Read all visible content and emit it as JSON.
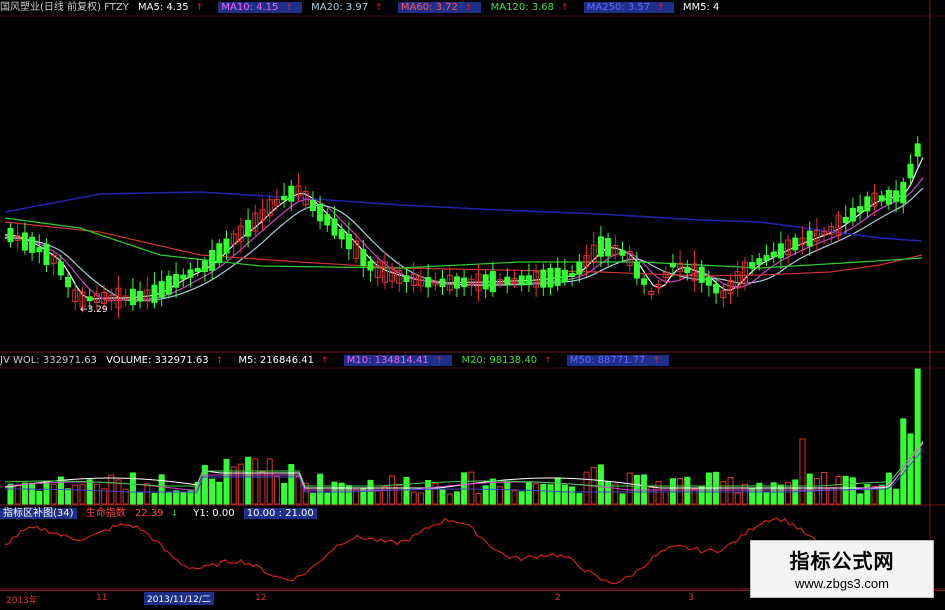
{
  "colors": {
    "background": "#000000",
    "up": "#e03030",
    "down": "#33ff33",
    "ma5": "#ffffff",
    "ma10": "#cc44cc",
    "ma20": "#aaccdd",
    "ma60": "#cc3333",
    "ma120": "#33cc33",
    "ma250": "#2222aa",
    "grid": "#7a1a1a"
  },
  "main_legend": {
    "title": "国风塑业(日线 前复权) FTZY",
    "ma5": "MA5: 4.35",
    "ma10": "MA10: 4.15",
    "ma20": "MA20: 3.97",
    "ma60": "MA60: 3.72",
    "ma120": "MA120: 3.68",
    "ma250": "MA250: 3.57",
    "mm5": "MM5: 4"
  },
  "min_price_label": "3.29",
  "vol_legend": {
    "name": "JV WOL: 332971.63",
    "volume": "VOLUME: 332971.63",
    "m5": "M5: 216846.41",
    "m10": "M10: 134814.41",
    "m20": "M20: 98138.40",
    "m50": "M50: 88771.77"
  },
  "ind_legend": {
    "title": "指标区补图(34)",
    "name": "生命指数",
    "value": "22.39",
    "y1": "Y1: 0.00",
    "range": "10.00 : 21.00"
  },
  "timebar": {
    "ticks": [
      "2013年",
      "11",
      "12",
      "2",
      "3"
    ],
    "cursor_date": "2013/11/12/二"
  },
  "watermark": {
    "title": "指标公式网",
    "url": "www.zbgs3.com"
  }
}
